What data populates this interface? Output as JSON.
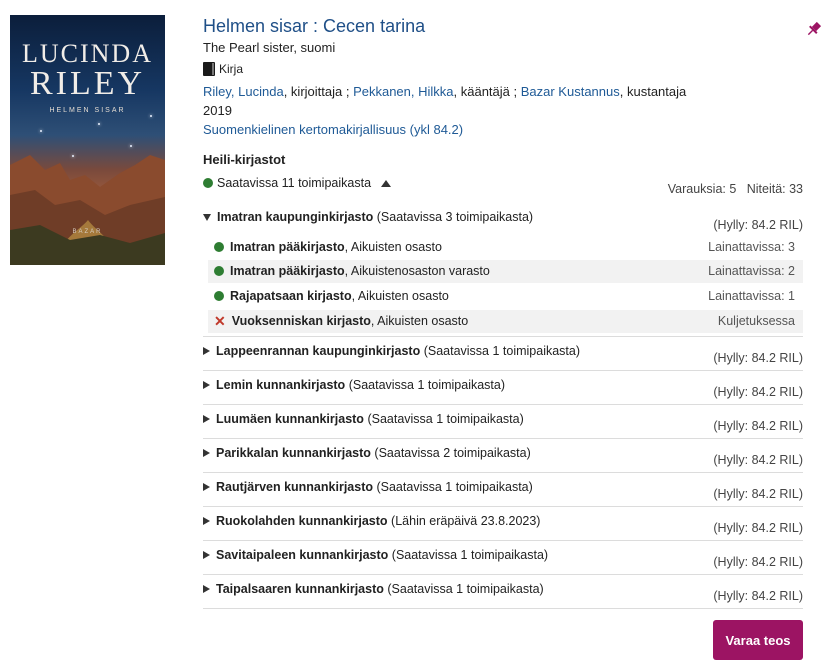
{
  "cover": {
    "author_line1": "LUCINDA",
    "author_line2": "RILEY",
    "subtitle": "HELMEN SISAR",
    "publisher": "BAZAR"
  },
  "record": {
    "title": "Helmen sisar : Cecen tarina",
    "original": "The Pearl sister, suomi",
    "format": "Kirja",
    "format_icon": "book-icon",
    "contributors": [
      {
        "name": "Riley, Lucinda",
        "role": ", kirjoittaja ; "
      },
      {
        "name": "Pekkanen, Hilkka",
        "role": ", kääntäjä ; "
      },
      {
        "name": "Bazar Kustannus",
        "role": ", kustantaja"
      }
    ],
    "year": "2019",
    "genre": "Suomenkielinen kertomakirjallisuus (ykl 84.2)",
    "pin_icon": "pushpin-icon"
  },
  "holdings": {
    "heading": "Heili-kirjastot",
    "summary": "Saatavissa 11 toimipaikasta",
    "reservations": "Varauksia: 5",
    "copies": "Niteitä: 33",
    "expanded": {
      "name": "Imatran kaupunginkirjasto",
      "note": "(Saatavissa 3 toimipaikasta)",
      "shelf": "(Hylly: 84.2 RIL)",
      "branches": [
        {
          "name": "Imatran pääkirjasto",
          "dept": ", Aikuisten osasto",
          "status": "Lainattavissa: 3",
          "state": "available"
        },
        {
          "name": "Imatran pääkirjasto",
          "dept": ", Aikuistenosaston varasto",
          "status": "Lainattavissa: 2",
          "state": "available"
        },
        {
          "name": "Rajapatsaan kirjasto",
          "dept": ", Aikuisten osasto",
          "status": "Lainattavissa: 1",
          "state": "available"
        },
        {
          "name": "Vuoksenniskan kirjasto",
          "dept": ", Aikuisten osasto",
          "status": "Kuljetuksessa",
          "state": "unavailable"
        }
      ]
    },
    "libraries": [
      {
        "name": "Lappeenrannan kaupunginkirjasto",
        "note": "(Saatavissa 1 toimipaikasta)",
        "shelf": "(Hylly: 84.2 RIL)"
      },
      {
        "name": "Lemin kunnankirjasto",
        "note": "(Saatavissa 1 toimipaikasta)",
        "shelf": "(Hylly: 84.2 RIL)"
      },
      {
        "name": "Luumäen kunnankirjasto",
        "note": "(Saatavissa 1 toimipaikasta)",
        "shelf": "(Hylly: 84.2 RIL)"
      },
      {
        "name": "Parikkalan kunnankirjasto",
        "note": "(Saatavissa 2 toimipaikasta)",
        "shelf": "(Hylly: 84.2 RIL)"
      },
      {
        "name": "Rautjärven kunnankirjasto",
        "note": "(Saatavissa 1 toimipaikasta)",
        "shelf": "(Hylly: 84.2 RIL)"
      },
      {
        "name": "Ruokolahden kunnankirjasto",
        "note": "(Lähin eräpäivä 23.8.2023)",
        "shelf": "(Hylly: 84.2 RIL)"
      },
      {
        "name": "Savitaipaleen kunnankirjasto",
        "note": "(Saatavissa 1 toimipaikasta)",
        "shelf": "(Hylly: 84.2 RIL)"
      },
      {
        "name": "Taipalsaaren kunnankirjasto",
        "note": "(Saatavissa 1 toimipaikasta)",
        "shelf": "(Hylly: 84.2 RIL)"
      }
    ]
  },
  "actions": {
    "reserve_label": "Varaa teos"
  },
  "colors": {
    "link": "#1f5a96",
    "available": "#2e7d32",
    "unavailable": "#c0392b",
    "button": "#9c1463"
  }
}
